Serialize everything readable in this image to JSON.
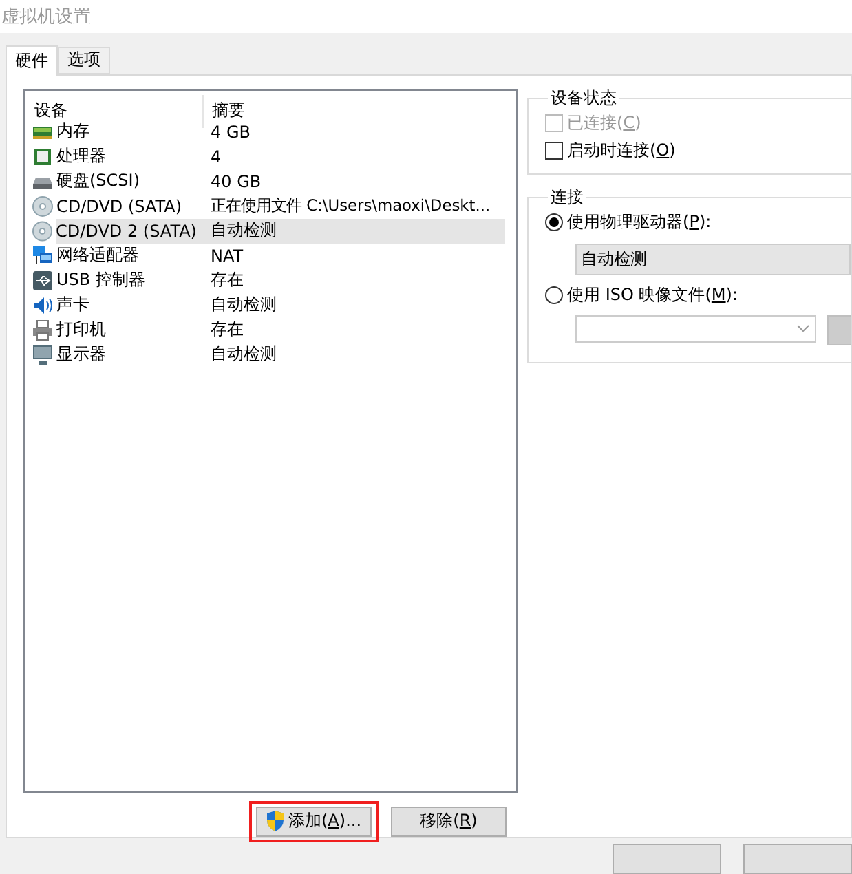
{
  "window": {
    "title": "虚拟机设置"
  },
  "tabs": [
    {
      "label": "硬件",
      "selected": true
    },
    {
      "label": "选项",
      "selected": false
    }
  ],
  "device_list": {
    "columns": [
      "设备",
      "摘要"
    ],
    "rows": [
      {
        "kind": "memory",
        "device": "内存",
        "summary": "4 GB",
        "selected": false
      },
      {
        "kind": "cpu",
        "device": "处理器",
        "summary": "4",
        "selected": false
      },
      {
        "kind": "disk",
        "device": "硬盘(SCSI)",
        "summary": "40 GB",
        "selected": false
      },
      {
        "kind": "cd",
        "device": "CD/DVD (SATA)",
        "summary": "正在使用文件 C:\\Users\\maoxi\\Deskt...",
        "selected": false
      },
      {
        "kind": "cd",
        "device": "CD/DVD 2 (SATA)",
        "summary": "自动检测",
        "selected": true
      },
      {
        "kind": "network",
        "device": "网络适配器",
        "summary": "NAT",
        "selected": false
      },
      {
        "kind": "usb",
        "device": "USB 控制器",
        "summary": "存在",
        "selected": false
      },
      {
        "kind": "sound",
        "device": "声卡",
        "summary": "自动检测",
        "selected": false
      },
      {
        "kind": "printer",
        "device": "打印机",
        "summary": "存在",
        "selected": false
      },
      {
        "kind": "display",
        "device": "显示器",
        "summary": "自动检测",
        "selected": false
      }
    ]
  },
  "device_status": {
    "title": "设备状态",
    "options": [
      {
        "before": "已连接(",
        "key": "C",
        "after": ")",
        "checked": false,
        "disabled": true
      },
      {
        "before": "启动时连接(",
        "key": "O",
        "after": ")",
        "checked": false,
        "disabled": false
      }
    ]
  },
  "connection": {
    "title": "连接",
    "options": [
      {
        "before": "使用物理驱动器(",
        "key": "P",
        "after": "):",
        "selected": true,
        "field_value": "自动检测"
      },
      {
        "before": "使用 ISO 映像文件(",
        "key": "M",
        "after": "):",
        "selected": false
      }
    ]
  },
  "buttons": [
    {
      "before": "添加(",
      "key": "A",
      "after": ")...",
      "shield": true,
      "highlighted": true
    },
    {
      "before": "移除(",
      "key": "R",
      "after": ")",
      "shield": false,
      "highlighted": false
    }
  ]
}
